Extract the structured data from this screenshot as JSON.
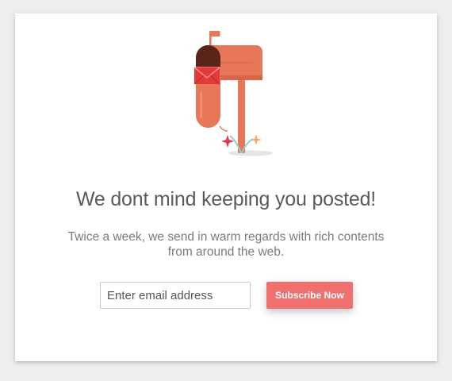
{
  "newsletter": {
    "headline": "We dont mind keeping you posted!",
    "subtitle": "Twice a week, we send in warm regards with rich contents from around the web.",
    "email_placeholder": "Enter email address",
    "subscribe_label": "Subscribe Now"
  },
  "colors": {
    "accent": "#f07070",
    "mailbox": "#e8775a",
    "mailbox_dark": "#5a2418",
    "envelope": "#e23a3a",
    "background": "#eeeeee",
    "card": "#ffffff"
  },
  "icons": [
    "mailbox-illustration",
    "envelope-icon",
    "flag-icon",
    "sparkle-icon"
  ]
}
